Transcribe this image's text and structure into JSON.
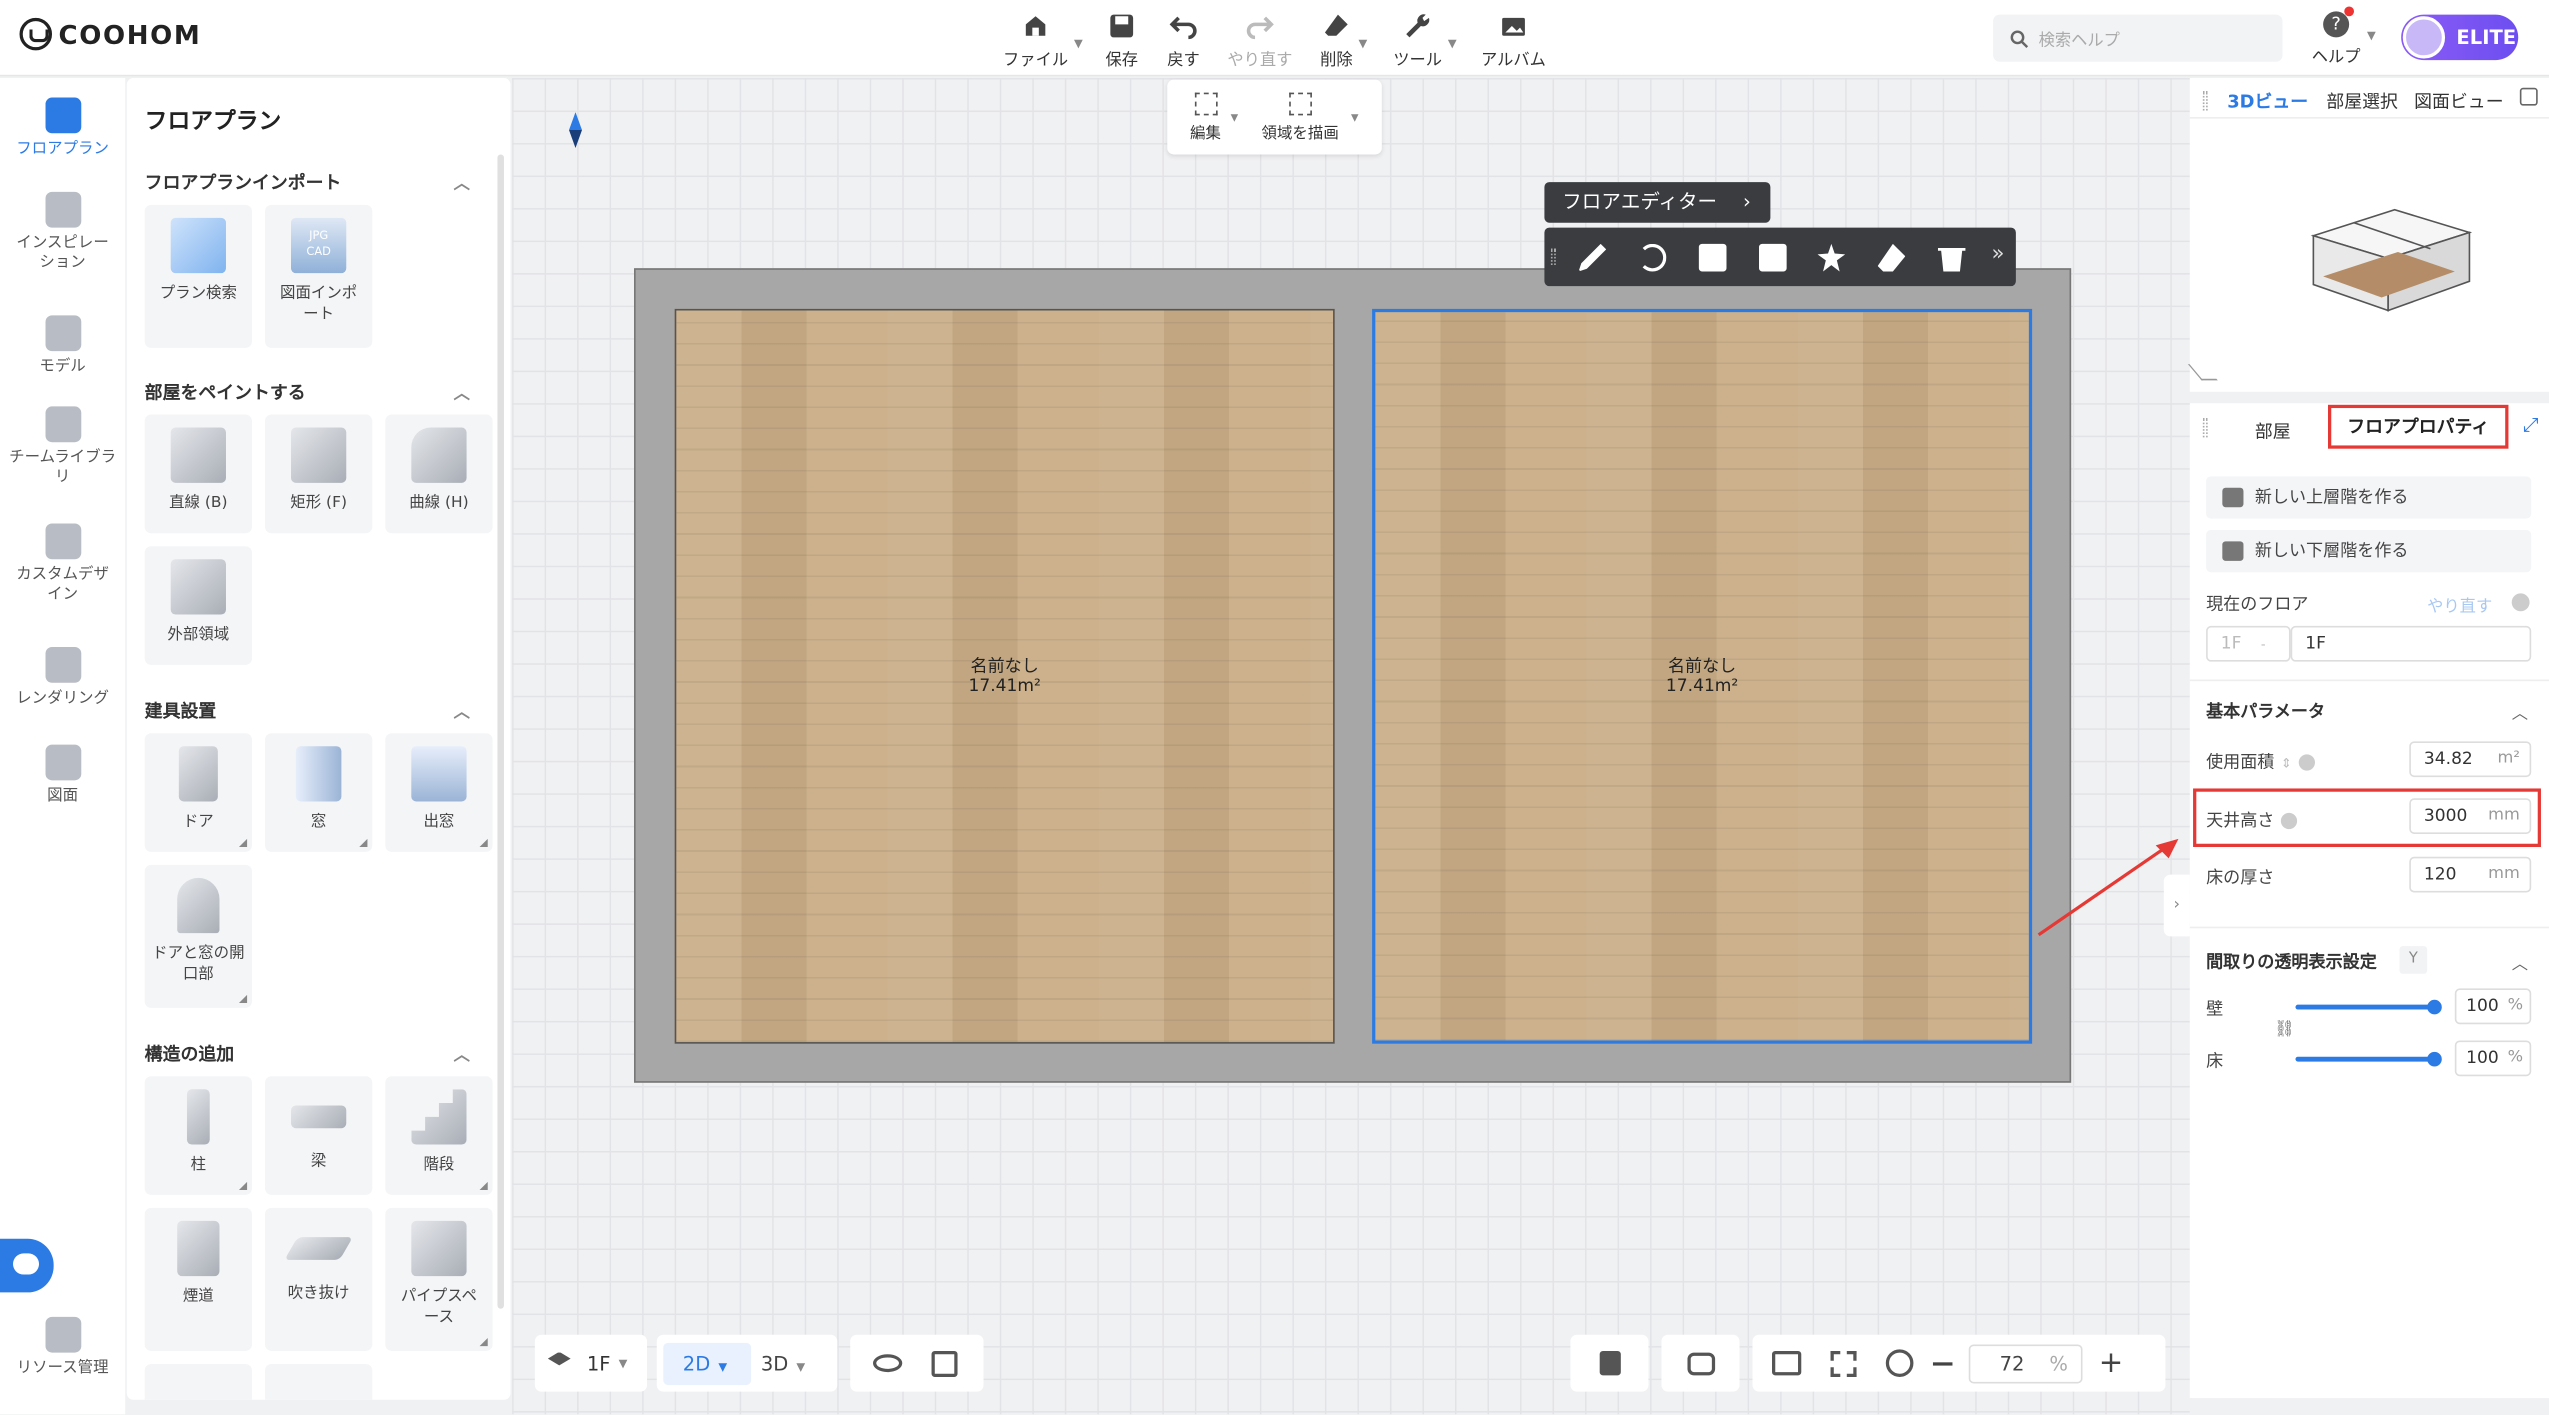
{
  "app": {
    "brand": "COOHOM",
    "avatar_badge": "ELITE"
  },
  "toolbar": {
    "file": "ファイル",
    "save": "保存",
    "undo": "戻す",
    "redo": "やり直す",
    "delete": "削除",
    "tools": "ツール",
    "album": "アルバム"
  },
  "search": {
    "placeholder": "検索ヘルプ"
  },
  "help": {
    "label": "ヘルプ"
  },
  "leftnav": [
    "フロアプラン",
    "インスピレーション",
    "モデル",
    "チームライブラリ",
    "カスタムデザイン",
    "レンダリング",
    "図面",
    "リソース管理"
  ],
  "panel": {
    "title": "フロアプラン",
    "import": {
      "title": "フロアプランインポート",
      "items": [
        "プラン検索",
        "図面インポート"
      ],
      "badges": [
        "JPG",
        "CAD"
      ]
    },
    "paint": {
      "title": "部屋をペイントする",
      "items": [
        "直線 (B)",
        "矩形 (F)",
        "曲線 (H)",
        "外部領域"
      ]
    },
    "fixtures": {
      "title": "建具設置",
      "items": [
        "ドア",
        "窓",
        "出窓",
        "ドアと窓の開口部"
      ]
    },
    "structure": {
      "title": "構造の追加",
      "items": [
        "柱",
        "梁",
        "階段",
        "煙道",
        "吹き抜け",
        "パイプスペース"
      ]
    }
  },
  "canvas": {
    "edit": {
      "edit": "編集",
      "draw_area": "領域を描画"
    },
    "floor_editor": "フロアエディター",
    "rooms": [
      {
        "name": "名前なし",
        "area": "17.41m²"
      },
      {
        "name": "名前なし",
        "area": "17.41m²"
      }
    ]
  },
  "bottom": {
    "floor": "1F",
    "mode2d": "2D",
    "mode3d": "3D",
    "zoom": "72",
    "zoom_unit": "%"
  },
  "right": {
    "view_tabs": [
      "3Dビュー",
      "部屋選択",
      "図面ビュー"
    ],
    "prop_tabs": {
      "room": "部屋",
      "floor_prop": "フロアプロパティ"
    },
    "new_upper": "新しい上層階を作る",
    "new_lower": "新しい下層階を作る",
    "current_floor": "現在のフロア",
    "redo_link": "やり直す",
    "floor_prefix": "1F",
    "floor_sep": "-",
    "floor_value": "1F",
    "basic": "基本パラメータ",
    "area_label": "使用面積",
    "area_value": "34.82",
    "area_unit": "m²",
    "ceiling_label": "天井高さ",
    "ceiling_value": "3000",
    "ceiling_unit": "mm",
    "thickness_label": "床の厚さ",
    "thickness_value": "120",
    "thickness_unit": "mm",
    "transparency": "間取りの透明表示設定",
    "trans_key": "Y",
    "wall_label": "壁",
    "wall_value": "100",
    "floor_label": "床",
    "floor_value2": "100",
    "pct": "%"
  },
  "colors": {
    "accent": "#2c7be5",
    "highlight": "#e53935"
  }
}
